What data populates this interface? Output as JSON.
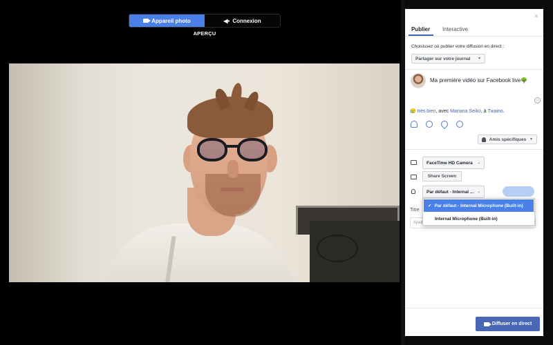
{
  "top_toggle": {
    "camera_label": "Appareil photo",
    "connection_label": "Connexion"
  },
  "preview_label": "APERÇU",
  "panel": {
    "close": "×",
    "tabs": [
      "Publier",
      "Interactive"
    ],
    "choose_text": "Choisissez où publier votre diffusion en direct :",
    "publish_target": "Partager sur votre journal",
    "post_text": "Ma première vidéo sur Facebook live",
    "post_emoji": "🌳",
    "feeling": {
      "emoji": "😥",
      "state": "très bien",
      "with_text": ", avec ",
      "person": "Mariana Seiko",
      "at_text": ", à ",
      "place": "Twaino",
      "end": "."
    },
    "audience": "Amis spécifiques",
    "camera_device": "FaceTime HD Camera",
    "share_screen": "Share Screen",
    "mic_selected": "Par défaut - Internal ...",
    "mic_options": [
      {
        "label": "Par défaut - Internal Microphone (Built-in)",
        "selected": true
      },
      {
        "label": "Internal Microphone (Built-in)",
        "selected": false
      }
    ],
    "title_label": "Titre",
    "title_placeholder": "Ajoutez un titre à votre diffusion en direct (facultatif)",
    "go_live": "Diffuser en direct"
  }
}
